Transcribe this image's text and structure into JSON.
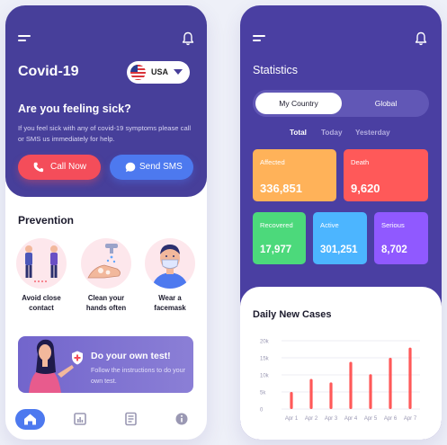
{
  "left": {
    "title": "Covid-19",
    "country": "USA",
    "question": "Are you feeling sick?",
    "advice": "If you feel sick with any of covid-19 symptoms please call or SMS us immediately for help.",
    "call_label": "Call Now",
    "sms_label": "Send SMS",
    "prevention_title": "Prevention",
    "prevention": [
      {
        "line1": "Avoid close",
        "line2": "contact"
      },
      {
        "line1": "Clean your",
        "line2": "hands often"
      },
      {
        "line1": "Wear a",
        "line2": "facemask"
      }
    ],
    "test_title": "Do your own test!",
    "test_text": "Follow the instructions to do your own test.",
    "nav": [
      "home-icon",
      "chart-icon",
      "news-icon",
      "info-icon"
    ]
  },
  "right": {
    "title": "Statistics",
    "tabs": {
      "active": "My Country",
      "inactive": "Global"
    },
    "periods": {
      "total": "Total",
      "today": "Today",
      "yesterday": "Yesterday"
    },
    "stats": {
      "affected": {
        "label": "Affected",
        "value": "336,851",
        "color": "#ffb259"
      },
      "death": {
        "label": "Death",
        "value": "9,620",
        "color": "#ff5959"
      },
      "recovered": {
        "label": "Recovered",
        "value": "17,977",
        "color": "#4cd97b"
      },
      "active": {
        "label": "Active",
        "value": "301,251",
        "color": "#4cb5ff"
      },
      "serious": {
        "label": "Serious",
        "value": "8,702",
        "color": "#9059ff"
      }
    }
  },
  "colors": {
    "primary": "#473f9a",
    "accent_red": "#f44d5a",
    "accent_blue": "#4d79ef",
    "bar": "#ff5959"
  },
  "chart_data": {
    "type": "bar",
    "title": "Daily New Cases",
    "categories": [
      "Apr 1",
      "Apr 2",
      "Apr 3",
      "Apr 4",
      "Apr 5",
      "Apr 6",
      "Apr 7"
    ],
    "values": [
      5000,
      8800,
      7800,
      13800,
      10200,
      15000,
      18000
    ],
    "yticks": [
      "20k",
      "15k",
      "10k",
      "5k",
      "0"
    ],
    "ylim": [
      0,
      20000
    ]
  }
}
